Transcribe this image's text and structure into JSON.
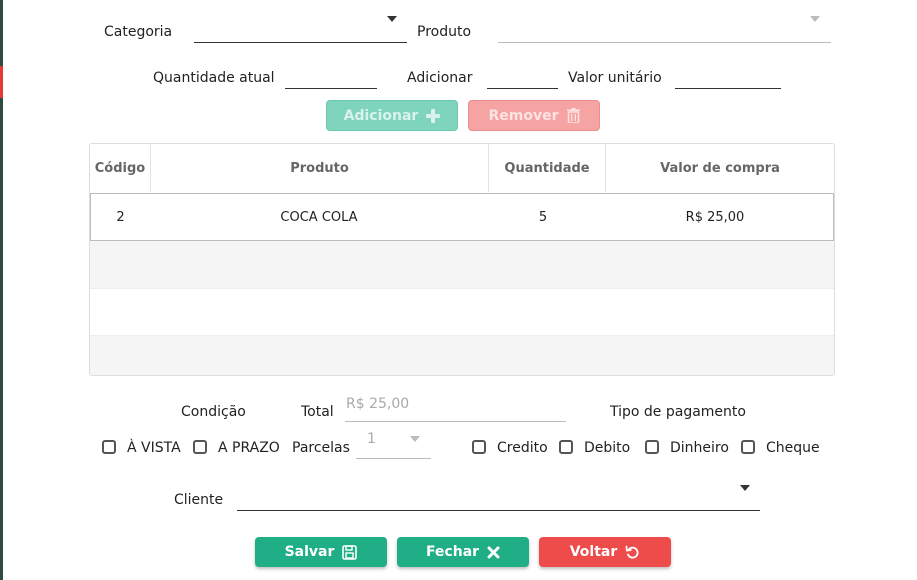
{
  "form": {
    "categoria_label": "Categoria",
    "produto_label": "Produto",
    "quantidade_atual_label": "Quantidade atual",
    "adicionar_label": "Adicionar",
    "valor_unitario_label": "Valor unitário"
  },
  "item_actions": {
    "add_label": "Adicionar",
    "add_icon": "plus-icon",
    "remove_label": "Remover",
    "remove_icon": "trash-icon"
  },
  "table": {
    "columns": [
      "Código",
      "Produto",
      "Quantidade",
      "Valor de compra"
    ],
    "rows": [
      {
        "codigo": "2",
        "produto": "COCA COLA",
        "quantidade": "5",
        "valor": "R$ 25,00"
      }
    ]
  },
  "payment": {
    "condicao_label": "Condição",
    "total_label": "Total",
    "total_value": "R$ 25,00",
    "tipo_label": "Tipo de pagamento",
    "a_vista_label": "À VISTA",
    "a_prazo_label": "A PRAZO",
    "parcelas_label": "Parcelas",
    "parcelas_value": "1",
    "credito_label": "Credito",
    "debito_label": "Debito",
    "dinheiro_label": "Dinheiro",
    "cheque_label": "Cheque"
  },
  "cliente": {
    "label": "Cliente"
  },
  "footer": {
    "salvar_label": "Salvar",
    "fechar_label": "Fechar",
    "voltar_label": "Voltar"
  },
  "colors": {
    "green": "#1fae85",
    "red": "#ee4b4b",
    "sidebar": "#2d4a43"
  }
}
